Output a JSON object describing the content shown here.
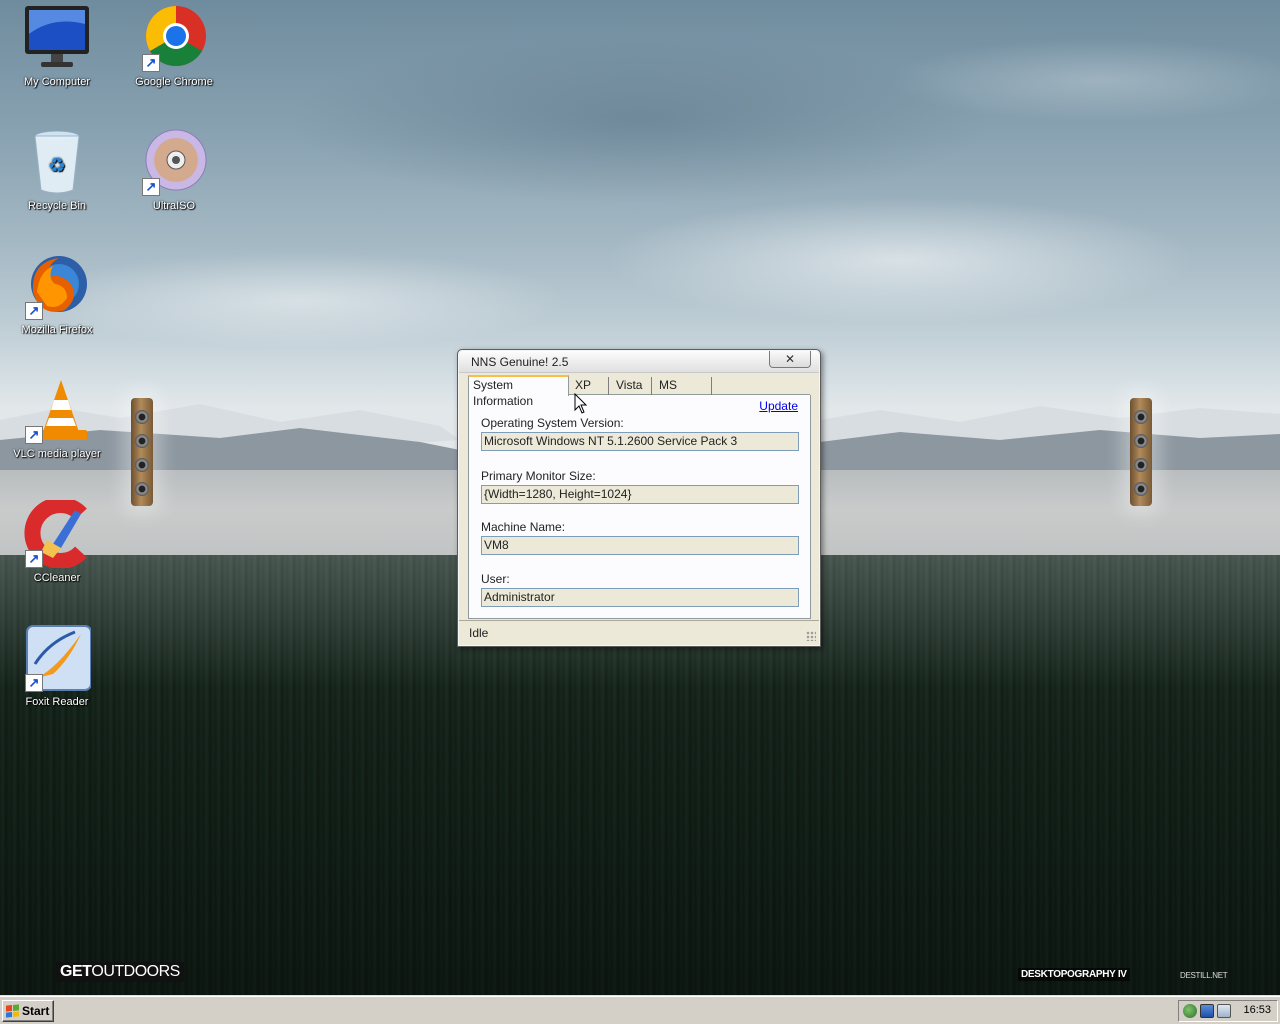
{
  "desktop": {
    "icons": [
      {
        "label": "My Computer",
        "icon": "monitor-icon",
        "shortcut": false
      },
      {
        "label": "Google Chrome",
        "icon": "chrome-icon",
        "shortcut": true
      },
      {
        "label": "Recycle Bin",
        "icon": "recycle-bin-icon",
        "shortcut": false
      },
      {
        "label": "UltraISO",
        "icon": "disc-icon",
        "shortcut": true
      },
      {
        "label": "Mozilla Firefox",
        "icon": "firefox-icon",
        "shortcut": true
      },
      {
        "label": "VLC media player",
        "icon": "vlc-cone-icon",
        "shortcut": true
      },
      {
        "label": "CCleaner",
        "icon": "ccleaner-icon",
        "shortcut": true
      },
      {
        "label": "Foxit Reader",
        "icon": "foxit-icon",
        "shortcut": true
      }
    ],
    "wallpaper": {
      "logo_left_bold": "GET",
      "logo_left_light": "OUTDOORS",
      "logo_right": "DESKTOPOGRAPHY IV",
      "logo_right_small": "DESTILL.NET"
    }
  },
  "window": {
    "title": "NNS Genuine! 2.5",
    "close_glyph": "✕",
    "tabs": [
      {
        "label": "System Information",
        "active": true
      },
      {
        "label": "XP",
        "active": false
      },
      {
        "label": "Vista",
        "active": false
      },
      {
        "label": "MS Office",
        "active": false
      }
    ],
    "update_link": "Update",
    "fields": [
      {
        "label": "Operating System Version:",
        "value": "Microsoft Windows NT 5.1.2600 Service Pack 3"
      },
      {
        "label": "Primary Monitor Size:",
        "value": "{Width=1280, Height=1024}"
      },
      {
        "label": "Machine Name:",
        "value": "VM8"
      },
      {
        "label": "User:",
        "value": "Administrator"
      }
    ],
    "status": "Idle"
  },
  "taskbar": {
    "start_label": "Start",
    "clock": "16:53",
    "tray_icons": [
      "network-globe-icon",
      "monitor-tray-icon",
      "volume-icon"
    ]
  },
  "colors": {
    "link": "#0000ee",
    "active_tab_accent": "#f7c044",
    "taskbar": "#d4d0c8"
  }
}
